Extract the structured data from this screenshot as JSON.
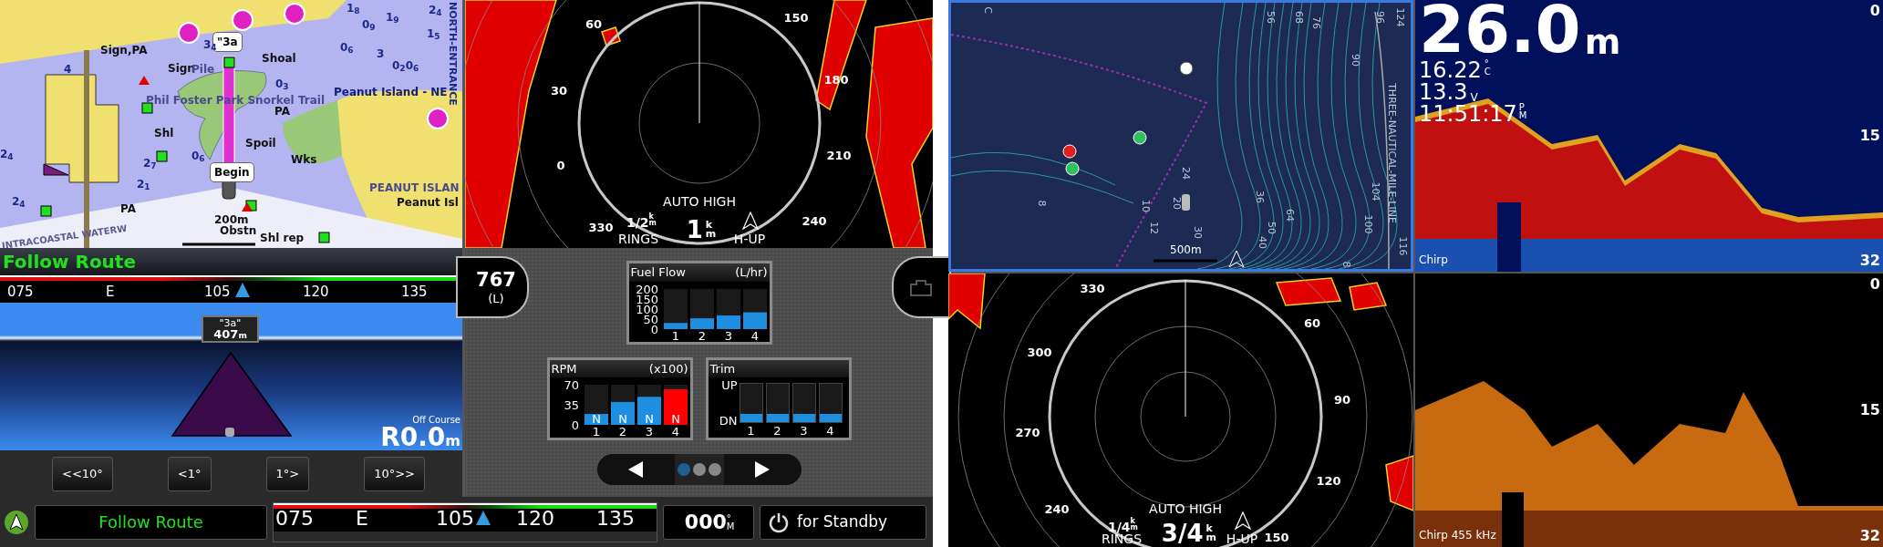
{
  "left_screen": {
    "nav_chart": {
      "labels": [
        {
          "text": "Sign,PA",
          "kind": "name"
        },
        {
          "text": "\"3a",
          "kind": "callout"
        },
        {
          "text": "Shoal",
          "kind": "name"
        },
        {
          "text": "Sign",
          "kind": "name"
        },
        {
          "text": "Pile",
          "kind": "faint"
        },
        {
          "text": "Phil Foster Park Snorkel Trail",
          "kind": "faint"
        },
        {
          "text": "Peanut Island - NE",
          "kind": "navy"
        },
        {
          "text": "PA",
          "kind": "name"
        },
        {
          "text": "Shl",
          "kind": "name"
        },
        {
          "text": "Spoil",
          "kind": "name"
        },
        {
          "text": "Wks",
          "kind": "name"
        },
        {
          "text": "Begin",
          "kind": "callout"
        },
        {
          "text": "PEANUT ISLAN",
          "kind": "faint"
        },
        {
          "text": "Peanut Isl",
          "kind": "name"
        },
        {
          "text": "PA",
          "kind": "name"
        },
        {
          "text": "200m",
          "kind": "name"
        },
        {
          "text": "Obstn",
          "kind": "name"
        },
        {
          "text": "Shl rep",
          "kind": "name"
        },
        {
          "text": "NORTH-ENTRANCE",
          "kind": "vertical"
        },
        {
          "text": "INTRACOASTAL WATERW",
          "kind": "slanted"
        },
        {
          "text": "3$_{4}$",
          "kind": "sounding"
        },
        {
          "text": "1$_{8}$",
          "kind": "sounding"
        },
        {
          "text": "0$_{9}$",
          "kind": "sounding"
        },
        {
          "text": "1$_{9}$",
          "kind": "sounding"
        },
        {
          "text": "1$_{5}$",
          "kind": "sounding"
        },
        {
          "text": "0$_{6}$",
          "kind": "sounding"
        },
        {
          "text": "3",
          "kind": "sounding"
        },
        {
          "text": "0$_{2}$0$_{6}$",
          "kind": "sounding"
        },
        {
          "text": "0$_{3}$",
          "kind": "sounding"
        },
        {
          "text": "4",
          "kind": "sounding"
        },
        {
          "text": "2$_{4}$",
          "kind": "sounding"
        },
        {
          "text": "0$_{6}$",
          "kind": "sounding"
        },
        {
          "text": "2$_{7}$",
          "kind": "sounding"
        },
        {
          "text": "2$_{1}$",
          "kind": "sounding"
        },
        {
          "text": "2$_{4}$",
          "kind": "sounding"
        },
        {
          "text": "2$_{4}$",
          "kind": "sounding"
        }
      ]
    },
    "radar": {
      "bearings": [
        "60",
        "150",
        "30",
        "180",
        "0",
        "210",
        "330",
        "240"
      ],
      "gain": "AUTO HIGH",
      "rings": "1/2",
      "rings_unit": "km",
      "rings_label": "RINGS",
      "range": "1",
      "range_unit": "km",
      "orientation": "H-UP"
    },
    "guidance": {
      "title": "Follow Route",
      "tape": [
        "075",
        "E",
        "105",
        "120",
        "135"
      ],
      "waypoint": "\"3a\"",
      "distance": "407",
      "distance_unit": "m",
      "off_course_label": "Off Course",
      "off_course": "R0.0",
      "off_course_unit": "m",
      "buttons": [
        "<<10°",
        "<1°",
        "1°>",
        "10°>>"
      ]
    },
    "gauges": {
      "fuel_total": "767",
      "fuel_unit": "(L)",
      "charts": [
        {
          "chart_data": {
            "type": "bar",
            "title": "Fuel Flow",
            "ylabel": "(L/hr)",
            "categories": [
              "1",
              "2",
              "3",
              "4"
            ],
            "ylim": [
              0,
              200
            ],
            "yticks": [
              0,
              50,
              100,
              150,
              200
            ],
            "series": [
              {
                "color": "#1e8fe0",
                "values": [
                  31,
                  54,
                  68,
                  84
                ]
              }
            ]
          }
        },
        {
          "chart_data": {
            "type": "bar",
            "title": "RPM",
            "ylabel": "(x100)",
            "categories": [
              "1",
              "2",
              "3",
              "4"
            ],
            "ylim": [
              0,
              70
            ],
            "yticks": [
              0,
              35,
              70
            ],
            "stacked": true,
            "value_labels": [
              "N",
              "N",
              "N",
              "N"
            ],
            "series": [
              {
                "color": "#1e8fe0",
                "values": [
                  19,
                  40,
                  49,
                  null
                ]
              },
              {
                "color": "#ff0000",
                "values": [
                  null,
                  null,
                  null,
                  62
                ]
              }
            ]
          }
        }
      ],
      "trim": {
        "title": "Trim",
        "top_label": "UP",
        "bottom_label": "DN",
        "bars": [
          {
            "label": "1",
            "level": 0.22
          },
          {
            "label": "2",
            "level": 0.22
          },
          {
            "label": "3",
            "level": 0.22
          },
          {
            "label": "4",
            "level": 0.22
          }
        ]
      },
      "pager": [
        {
          "selected": true
        },
        {
          "selected": false
        },
        {
          "selected": false
        }
      ]
    },
    "status_bar": {
      "mode": "Follow Route",
      "tape": [
        "075",
        "E",
        "105",
        "120",
        "135"
      ],
      "heading": "000",
      "heading_unit": "°M",
      "standby": "for Standby"
    }
  },
  "right_screen": {
    "chart": {
      "contours": [
        "56",
        "68",
        "76",
        "96",
        "124",
        "90",
        "THREE-NAUTICAL-MILE-LINE",
        "104",
        "100",
        "116",
        "64",
        "50",
        "40",
        "36",
        "30",
        "24",
        "20",
        "12",
        "10",
        "8",
        "8",
        "C"
      ],
      "scale": "500m"
    },
    "sonar_top": {
      "depth": "26.0",
      "depth_unit": "m",
      "temperature": "16.22",
      "temperature_unit": "°C",
      "voltage": "13.3",
      "voltage_unit": "V",
      "time": "11:51:17",
      "time_unit": "PM",
      "scale": [
        "0",
        "15",
        "32"
      ],
      "mode": "Chirp"
    },
    "radar": {
      "bearings": [
        "330",
        "60",
        "300",
        "90",
        "270",
        "120",
        "240",
        "150"
      ],
      "gain": "AUTO HIGH",
      "rings": "1/4",
      "rings_unit": "km",
      "rings_label": "RINGS",
      "range": "3/4",
      "range_unit": "km",
      "orientation": "H-UP"
    },
    "sonar_bottom": {
      "scale": [
        "0",
        "15",
        "32"
      ],
      "mode": "Chirp 455 kHz"
    }
  }
}
